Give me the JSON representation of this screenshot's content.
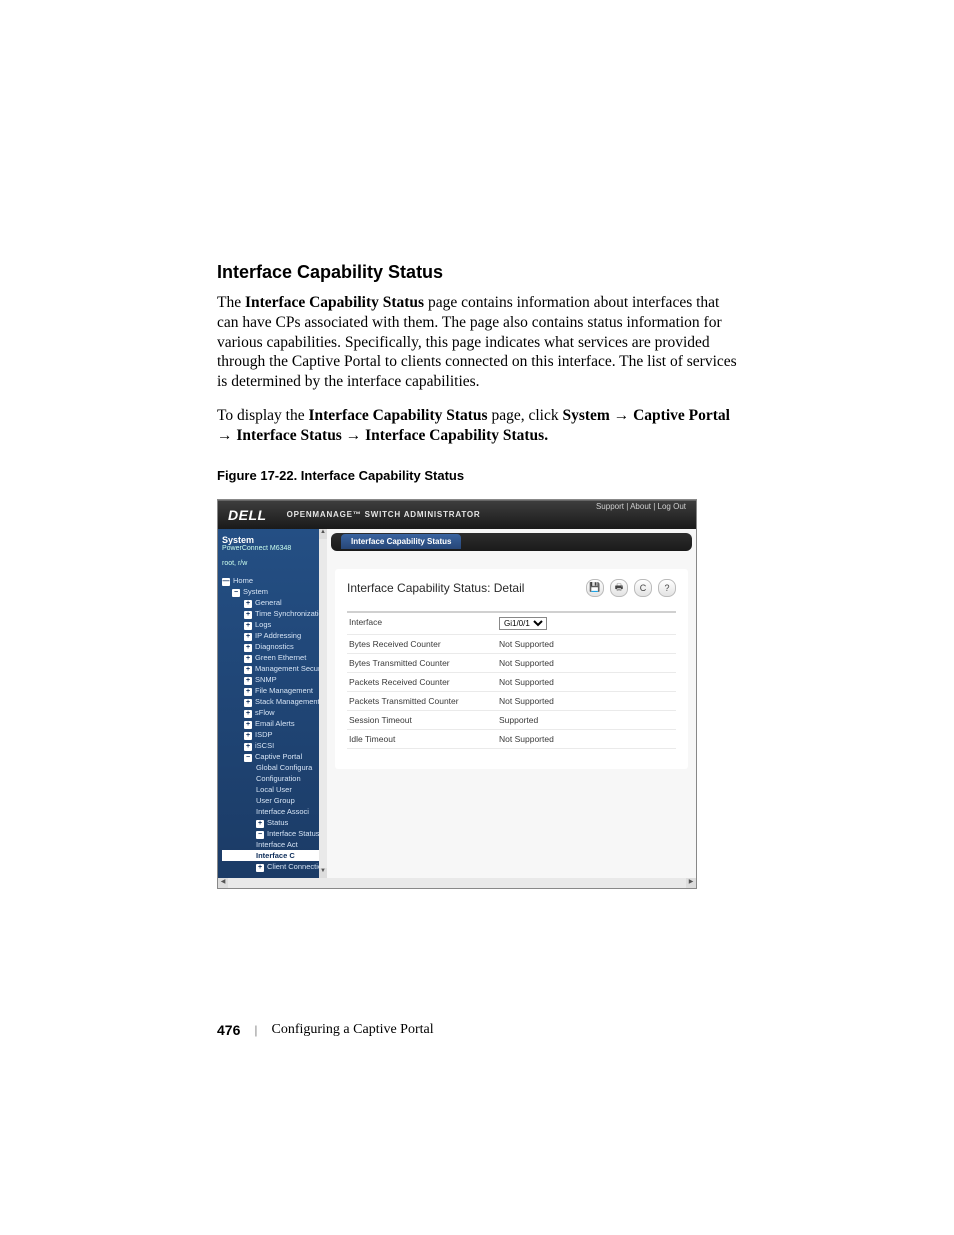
{
  "section": {
    "title": "Interface Capability Status",
    "para1_a": "The ",
    "para1_b": "Interface Capability Status",
    "para1_c": " page contains information about interfaces that can have CPs associated with them. The page also contains status information for various capabilities. Specifically, this page indicates what services are provided through the Captive Portal to clients connected on this interface. The list of services is determined by the interface capabilities.",
    "para2_a": "To display the ",
    "para2_b": "Interface Capability Status",
    "para2_c": " page, click ",
    "para2_d": "System",
    "arrow": " → ",
    "para2_e": "Captive Portal",
    "para2_f": "Interface Status",
    "para2_g": "Interface Capability Status."
  },
  "figure_caption": "Figure 17-22.    Interface Capability Status",
  "app": {
    "logo": "DELL",
    "product": "OPENMANAGE™ SWITCH ADMINISTRATOR",
    "toplinks": {
      "support": "Support",
      "about": "About",
      "logout": "Log Out",
      "sep": " | "
    },
    "nav": {
      "title": "System",
      "subtitle1": "PowerConnect M6348",
      "subtitle2": "root, r/w",
      "items": [
        {
          "label": "Home",
          "cls": "",
          "exp": "—"
        },
        {
          "label": "System",
          "cls": "ind1",
          "exp": "−"
        },
        {
          "label": "General",
          "cls": "ind2",
          "exp": "+"
        },
        {
          "label": "Time Synchronization",
          "cls": "ind2",
          "exp": "+"
        },
        {
          "label": "Logs",
          "cls": "ind2",
          "exp": "+"
        },
        {
          "label": "IP Addressing",
          "cls": "ind2",
          "exp": "+"
        },
        {
          "label": "Diagnostics",
          "cls": "ind2",
          "exp": "+"
        },
        {
          "label": "Green Ethernet",
          "cls": "ind2",
          "exp": "+"
        },
        {
          "label": "Management Security",
          "cls": "ind2",
          "exp": "+"
        },
        {
          "label": "SNMP",
          "cls": "ind2",
          "exp": "+"
        },
        {
          "label": "File Management",
          "cls": "ind2",
          "exp": "+"
        },
        {
          "label": "Stack Management",
          "cls": "ind2",
          "exp": "+"
        },
        {
          "label": "sFlow",
          "cls": "ind2",
          "exp": "+"
        },
        {
          "label": "Email Alerts",
          "cls": "ind2",
          "exp": "+"
        },
        {
          "label": "ISDP",
          "cls": "ind2",
          "exp": "+"
        },
        {
          "label": "iSCSI",
          "cls": "ind2",
          "exp": "+"
        },
        {
          "label": "Captive Portal",
          "cls": "ind2",
          "exp": "−"
        },
        {
          "label": "Global Configura",
          "cls": "ind3",
          "exp": ""
        },
        {
          "label": "Configuration",
          "cls": "ind3",
          "exp": ""
        },
        {
          "label": "Local User",
          "cls": "ind3",
          "exp": ""
        },
        {
          "label": "User Group",
          "cls": "ind3",
          "exp": ""
        },
        {
          "label": "Interface Associ",
          "cls": "ind3",
          "exp": ""
        },
        {
          "label": "Status",
          "cls": "ind3",
          "exp": "+"
        },
        {
          "label": "Interface Status",
          "cls": "ind3",
          "exp": "−"
        },
        {
          "label": "Interface Act",
          "cls": "ind3 plain",
          "exp": ""
        },
        {
          "label": "Interface C",
          "cls": "ind3 sel",
          "exp": ""
        },
        {
          "label": "Client Connectio",
          "cls": "ind3",
          "exp": "+"
        }
      ]
    },
    "tab": "Interface Capability Status",
    "panel_title": "Interface Capability Status: Detail",
    "interface_value": "Gi1/0/1",
    "rows": [
      {
        "label": "Interface",
        "value": ""
      },
      {
        "label": "Bytes Received Counter",
        "value": "Not Supported"
      },
      {
        "label": "Bytes Transmitted Counter",
        "value": "Not Supported"
      },
      {
        "label": "Packets Received Counter",
        "value": "Not Supported"
      },
      {
        "label": "Packets Transmitted Counter",
        "value": "Not Supported"
      },
      {
        "label": "Session Timeout",
        "value": "Supported"
      },
      {
        "label": "Idle Timeout",
        "value": "Not Supported"
      }
    ]
  },
  "footer": {
    "page": "476",
    "doc": "Configuring a Captive Portal"
  }
}
